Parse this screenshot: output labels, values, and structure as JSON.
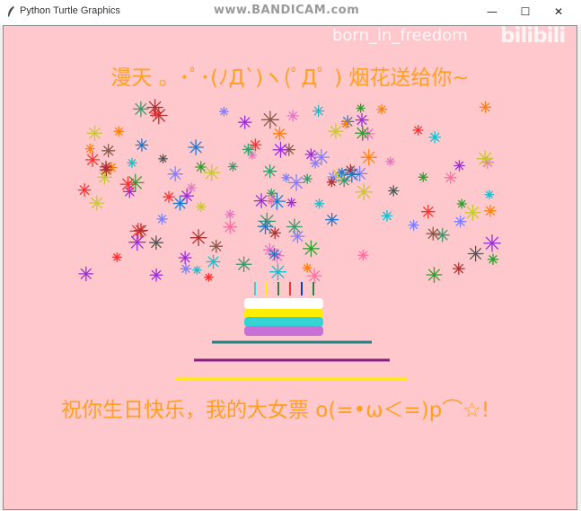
{
  "window": {
    "title": "Python Turtle Graphics",
    "recording_watermark": "www.BANDICAM.com",
    "minimize_label": "—",
    "maximize_label": "☐",
    "close_label": "✕"
  },
  "canvas": {
    "background": "#ffc8cc",
    "headline": "漫天 。･ﾟ･(ﾉД`)ヽ(ﾟДﾟ ) 烟花送给你~",
    "bottom_text": "祝你生日快乐，我的大女票 o(=•ω＜=)p⌒☆!",
    "brand_text": "born_in_freedom",
    "brand_logo": "bilibili",
    "text_color": "#ffa020"
  },
  "icons": {
    "app": "feather-icon",
    "minimize": "minimize-icon",
    "maximize": "maximize-icon",
    "close": "close-icon"
  },
  "cake": {
    "layers": [
      "#ffffff",
      "#ffee00",
      "#35d4d4",
      "#c870d8"
    ],
    "candle_colors": [
      "#35d4d4",
      "#ffee00",
      "#228844",
      "#ff3030",
      "#1040c0",
      "#228844"
    ],
    "lines": [
      "#208080",
      "#8a2080",
      "#ffee00"
    ]
  }
}
